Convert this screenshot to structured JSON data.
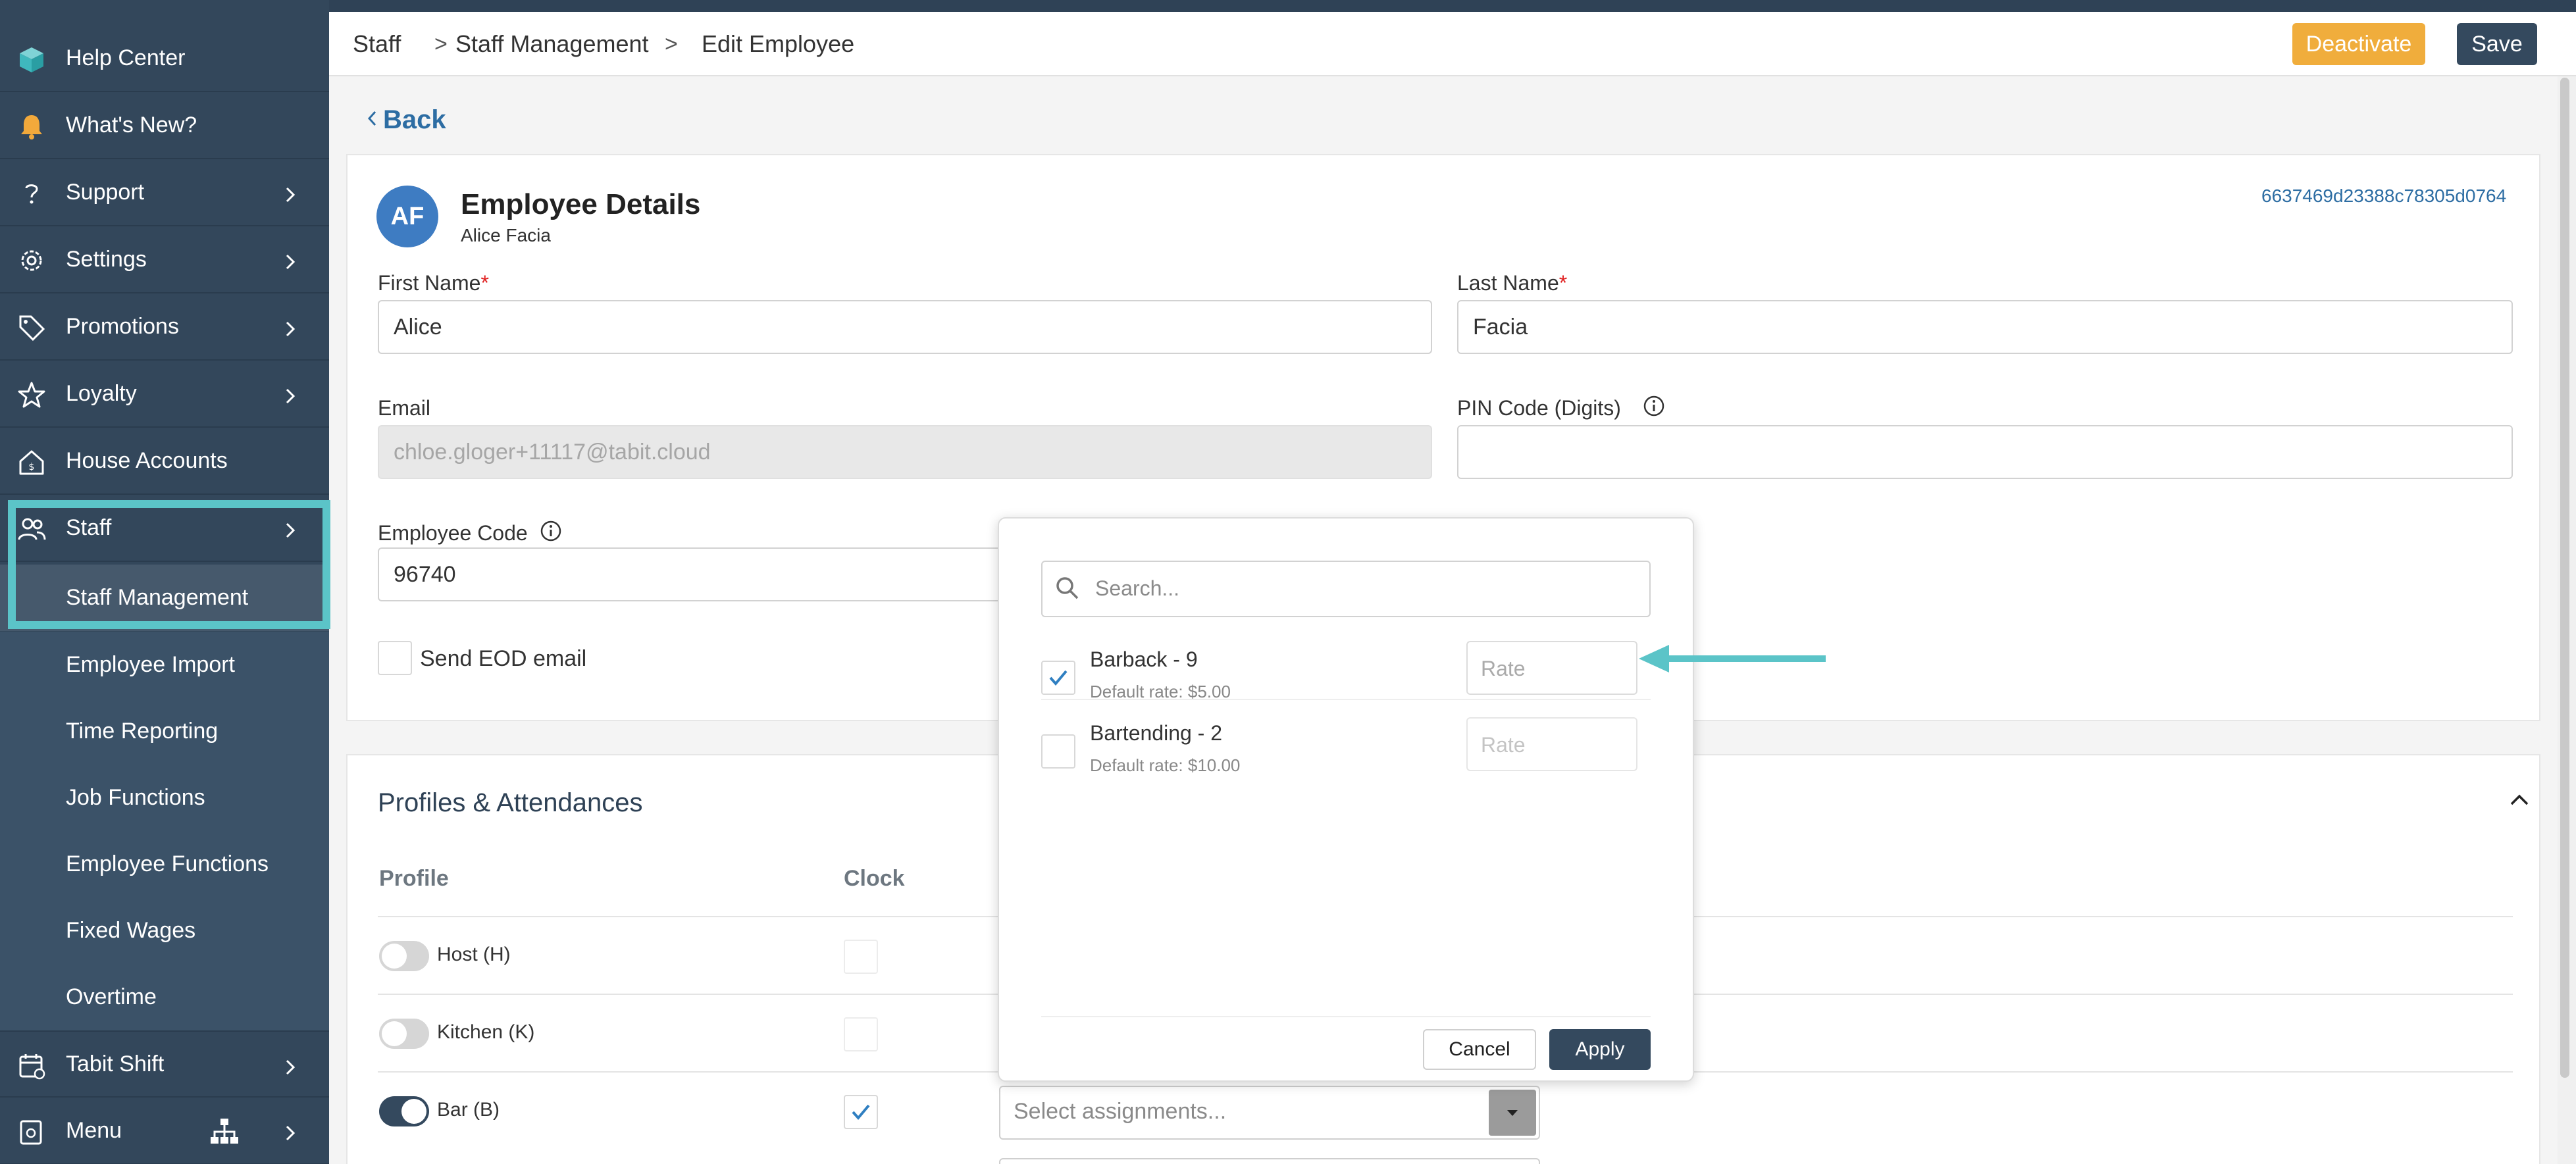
{
  "sidebar": {
    "items": [
      {
        "label": "Help Center"
      },
      {
        "label": "What's New?"
      },
      {
        "label": "Support"
      },
      {
        "label": "Settings"
      },
      {
        "label": "Promotions"
      },
      {
        "label": "Loyalty"
      },
      {
        "label": "House Accounts"
      },
      {
        "label": "Staff"
      }
    ],
    "staff_sub": [
      {
        "label": "Staff Management"
      },
      {
        "label": "Employee Import"
      },
      {
        "label": "Time Reporting"
      },
      {
        "label": "Job Functions"
      },
      {
        "label": "Employee Functions"
      },
      {
        "label": "Fixed Wages"
      },
      {
        "label": "Overtime"
      }
    ],
    "bottom_items": [
      {
        "label": "Tabit Shift"
      },
      {
        "label": "Menu"
      }
    ]
  },
  "breadcrumb": [
    "Staff",
    "Staff Management",
    "Edit Employee"
  ],
  "breadcrumb_sep": ">",
  "toolbar": {
    "deactivate_label": "Deactivate",
    "save_label": "Save"
  },
  "back_label": "Back",
  "employee": {
    "initials": "AF",
    "section_title": "Employee Details",
    "full_name": "Alice Facia",
    "id": "6637469d23388c78305d0764",
    "first_name_label": "First Name",
    "first_name": "Alice",
    "last_name_label": "Last Name",
    "last_name": "Facia",
    "required_mark": "*",
    "email_label": "Email",
    "email": "chloe.gloger+11117@tabit.cloud",
    "pin_label": "PIN Code (Digits)",
    "pin": "",
    "code_label": "Employee Code",
    "code": "96740",
    "send_eod_label": "Send EOD email"
  },
  "profiles": {
    "title": "Profiles & Attendances",
    "col_profile": "Profile",
    "col_clock": "Clock",
    "rows": [
      {
        "name": "Host (H)",
        "enabled": false,
        "clock": false
      },
      {
        "name": "Kitchen (K)",
        "enabled": false,
        "clock": false
      },
      {
        "name": "Bar (B)",
        "enabled": true,
        "clock": true
      }
    ],
    "assignments_placeholder": "Select assignments..."
  },
  "popup": {
    "search_placeholder": "Search...",
    "items": [
      {
        "name": "Barback - 9",
        "default_rate": "Default rate: $5.00",
        "checked": true,
        "rate_placeholder": "Rate"
      },
      {
        "name": "Bartending - 2",
        "default_rate": "Default rate: $10.00",
        "checked": false,
        "rate_placeholder": "Rate"
      }
    ],
    "cancel_label": "Cancel",
    "apply_label": "Apply"
  },
  "colors": {
    "sidebar_bg": "#33475b",
    "highlight": "#5bc4c8",
    "deactivate": "#f0ad3c",
    "save": "#34495e",
    "link": "#2d6da3",
    "checkbox_blue": "#2f7fc1",
    "arrow": "#5bc4c8"
  }
}
